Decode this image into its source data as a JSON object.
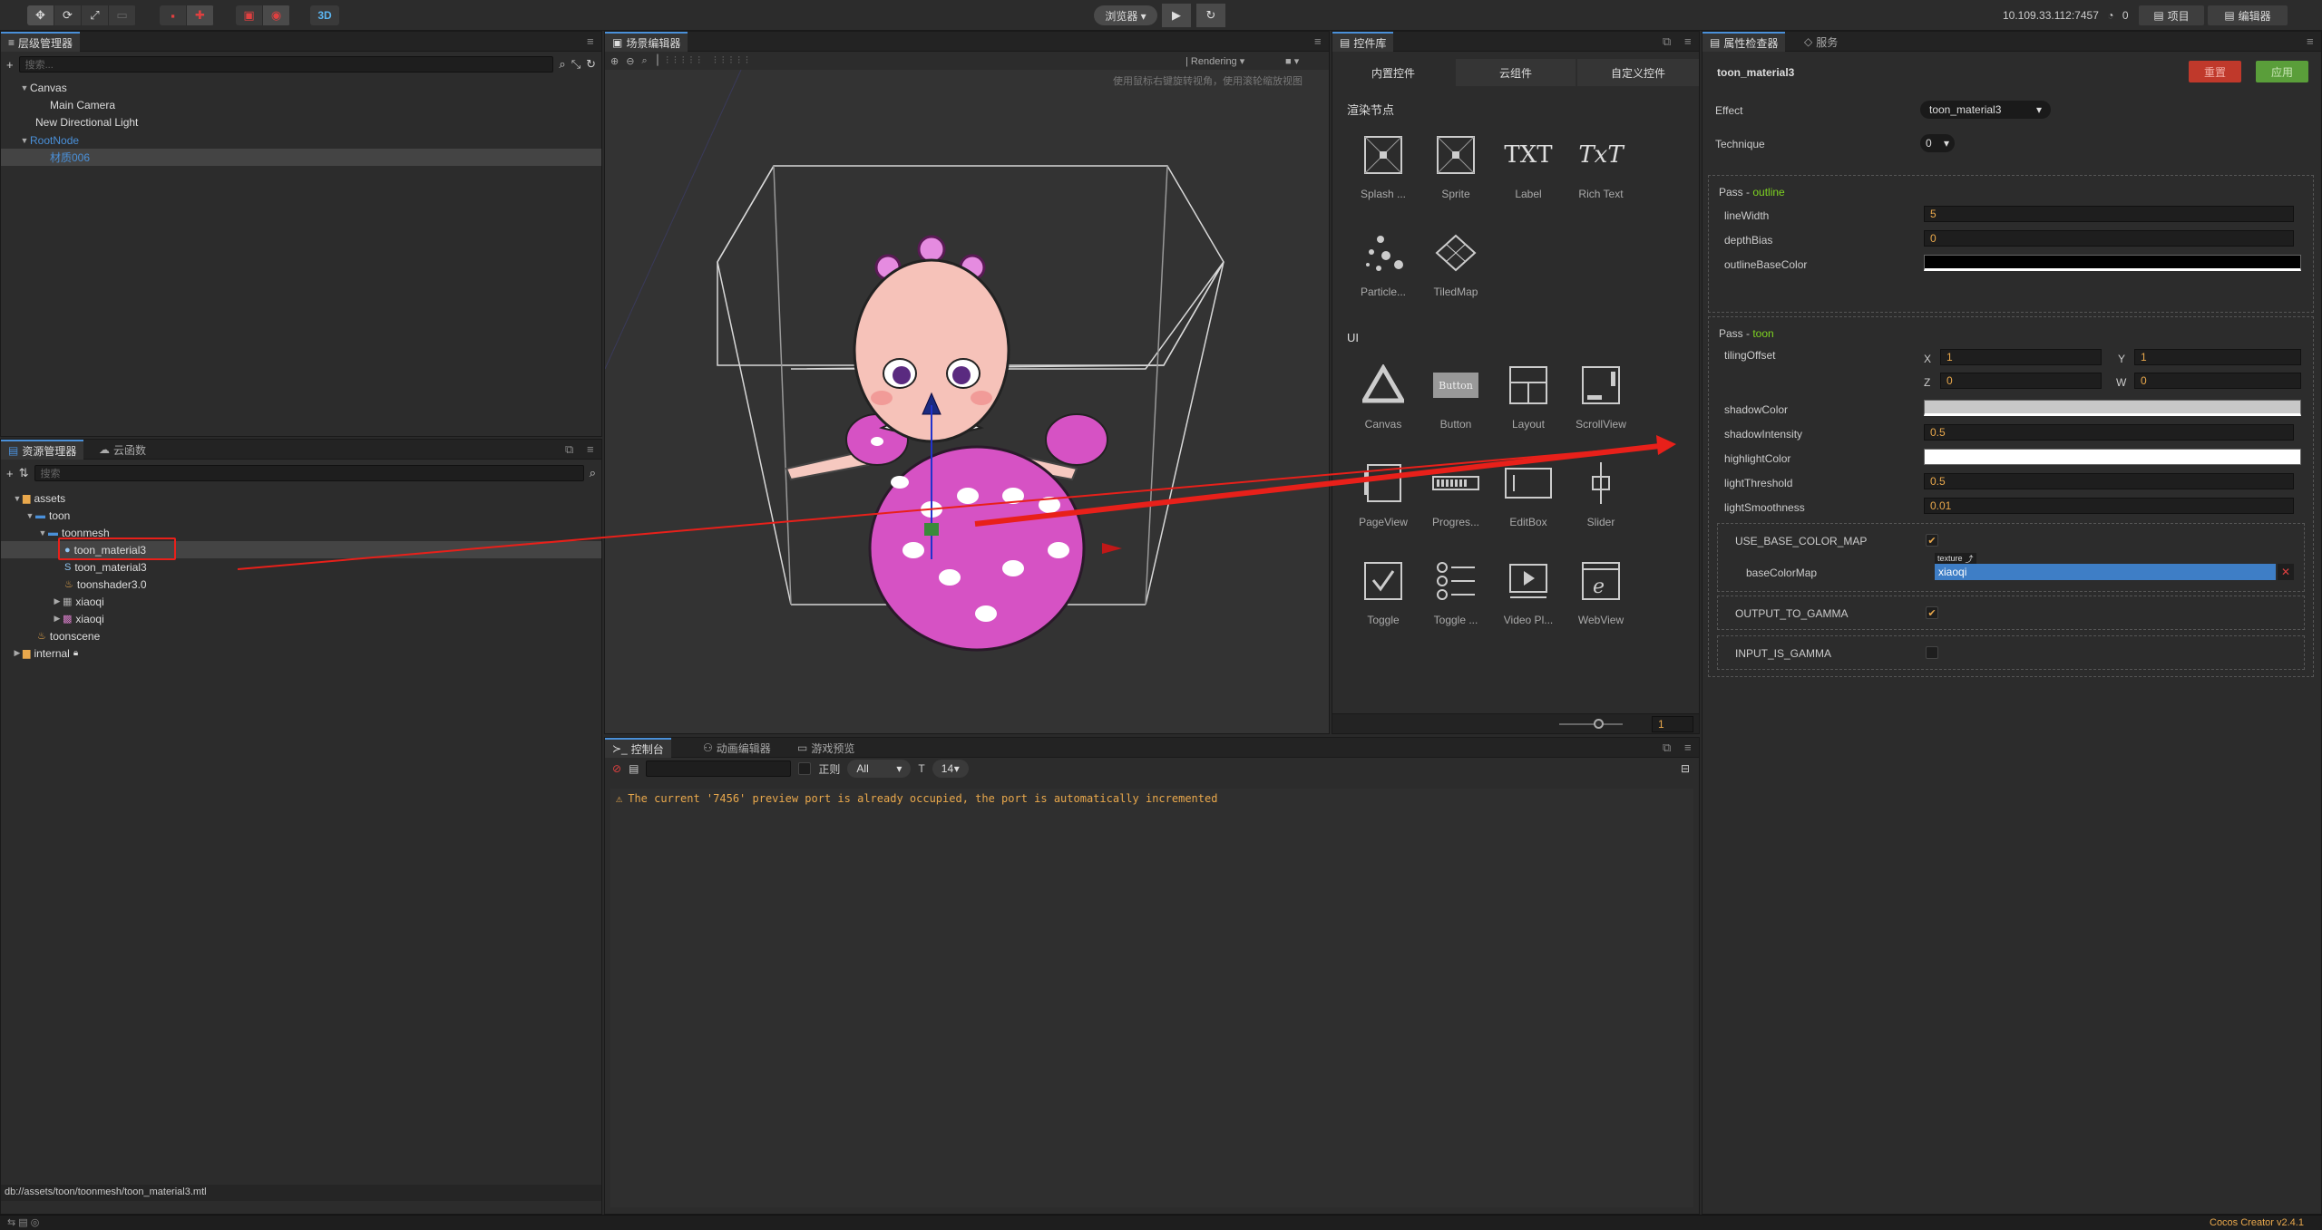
{
  "toolbar": {
    "mode3d": "3D",
    "browser": "浏览器 ▾",
    "ip": "10.109.33.112:7457",
    "wifi_count": "0",
    "project": "项目",
    "editor": "编辑器"
  },
  "hierarchy": {
    "tab": "层级管理器",
    "search_placeholder": "搜索...",
    "nodes": [
      "Canvas",
      "Main Camera",
      "New Directional Light",
      "RootNode",
      "材质006"
    ]
  },
  "assets": {
    "tab": "资源管理器",
    "tab2": "云函数",
    "search_placeholder": "搜索",
    "items": [
      "assets",
      "toon",
      "toonmesh",
      "toon_material3",
      "toon_material3",
      "toonshader3.0",
      "xiaoqi",
      "xiaoqi",
      "toonscene",
      "internal"
    ],
    "path": "db://assets/toon/toonmesh/toon_material3.mtl"
  },
  "scene": {
    "tab": "场景编辑器",
    "rendering": "Rendering",
    "hint": "使用鼠标右键旋转视角，使用滚轮缩放视图"
  },
  "widgets": {
    "tab": "控件库",
    "tabs": [
      "内置控件",
      "云组件",
      "自定义控件"
    ],
    "section_render": "渲染节点",
    "section_ui": "UI",
    "render_items": [
      "Splash ...",
      "Sprite",
      "Label",
      "Rich Text",
      "Particle...",
      "TiledMap"
    ],
    "label_icon": "TXT",
    "richtext_icon": "TxT",
    "ui_items": [
      "Canvas",
      "Button",
      "Layout",
      "ScrollView",
      "PageView",
      "Progres...",
      "EditBox",
      "Slider",
      "Toggle",
      "Toggle ...",
      "Video Pl...",
      "WebView"
    ],
    "button_icon": "Button",
    "zoom_value": "1"
  },
  "console": {
    "tabs": [
      "控制台",
      "动画编辑器",
      "游戏预览"
    ],
    "regex": "正则",
    "level": "All",
    "font_size": "14",
    "message": "The current '7456' preview port is already occupied, the port is automatically incremented"
  },
  "inspector": {
    "tab": "属性检查器",
    "tab2": "服务",
    "title": "toon_material3",
    "revert": "重置",
    "apply": "应用",
    "effect_label": "Effect",
    "effect_value": "toon_material3",
    "technique_label": "Technique",
    "technique_value": "0",
    "pass1_prefix": "Pass - ",
    "pass1_name": "outline",
    "lineWidth_label": "lineWidth",
    "lineWidth": "5",
    "depthBias_label": "depthBias",
    "depthBias": "0",
    "outlineBaseColor_label": "outlineBaseColor",
    "pass2_prefix": "Pass - ",
    "pass2_name": "toon",
    "tilingOffset_label": "tilingOffset",
    "tx_label": "X",
    "tx": "1",
    "ty_label": "Y",
    "ty": "1",
    "tz_label": "Z",
    "tz": "0",
    "tw_label": "W",
    "tw": "0",
    "shadowColor_label": "shadowColor",
    "shadowIntensity_label": "shadowIntensity",
    "shadowIntensity": "0.5",
    "highlightColor_label": "highlightColor",
    "lightThreshold_label": "lightThreshold",
    "lightThreshold": "0.5",
    "lightSmoothness_label": "lightSmoothness",
    "lightSmoothness": "0.01",
    "use_base_color_map": "USE_BASE_COLOR_MAP",
    "baseColorMap_label": "baseColorMap",
    "texture_tag": "texture",
    "baseColorMap_value": "xiaoqi",
    "output_to_gamma": "OUTPUT_TO_GAMMA",
    "input_is_gamma": "INPUT_IS_GAMMA"
  },
  "footer": {
    "version": "Cocos Creator v2.4.1"
  },
  "colors": {
    "accent_blue": "#4a90d9",
    "pass_green": "#7ed321",
    "input_orange": "#e9a84c",
    "revert_red": "#c0392b",
    "apply_green": "#5a9e3a",
    "annotation_red": "#e8201a"
  }
}
